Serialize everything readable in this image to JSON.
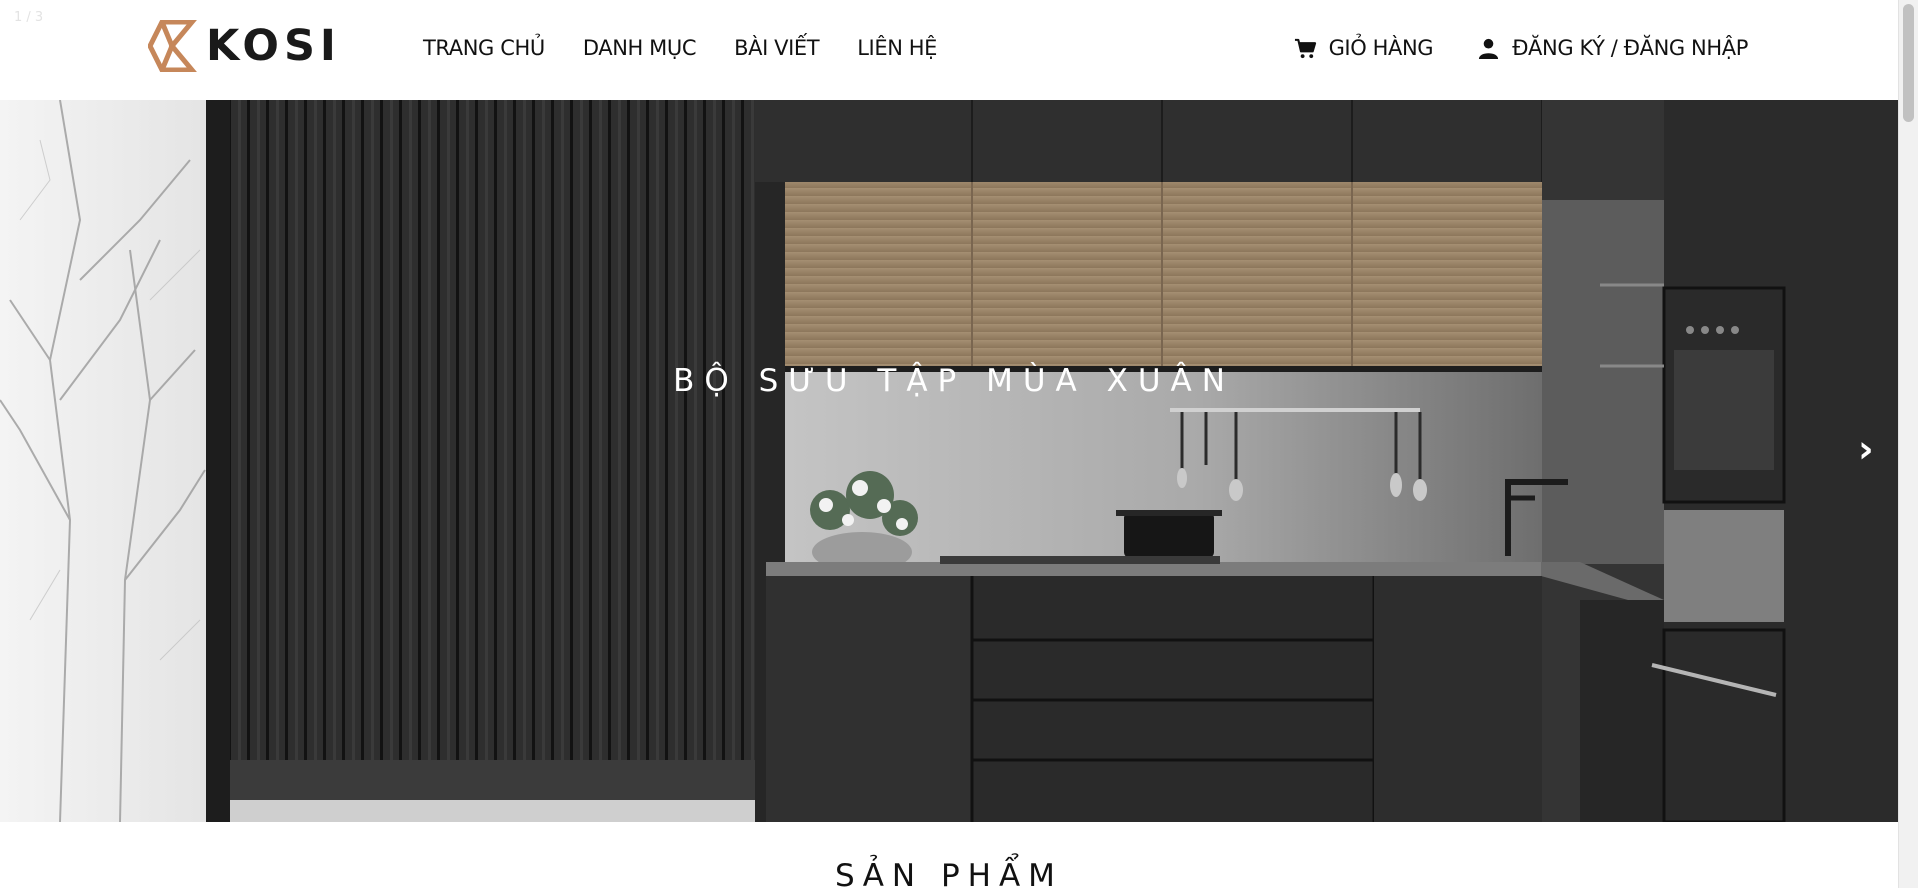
{
  "slider": {
    "counter": "1 / 3"
  },
  "brand": {
    "name": "KOSI",
    "accent_color": "#c6875a"
  },
  "nav": {
    "items": [
      {
        "label": "TRANG CHỦ"
      },
      {
        "label": "DANH MỤC"
      },
      {
        "label": "BÀI VIẾT"
      },
      {
        "label": "LIÊN HỆ"
      }
    ]
  },
  "account": {
    "cart_label": "GIỎ HÀNG",
    "cart_icon": "cart-icon",
    "auth_label": "ĐĂNG KÝ / ĐĂNG NHẬP",
    "auth_icon": "user-icon"
  },
  "hero": {
    "caption": "BỘ SƯU TẬP MÙA XUÂN",
    "next_symbol": "›"
  },
  "section": {
    "title": "SẢN PHẨM"
  }
}
